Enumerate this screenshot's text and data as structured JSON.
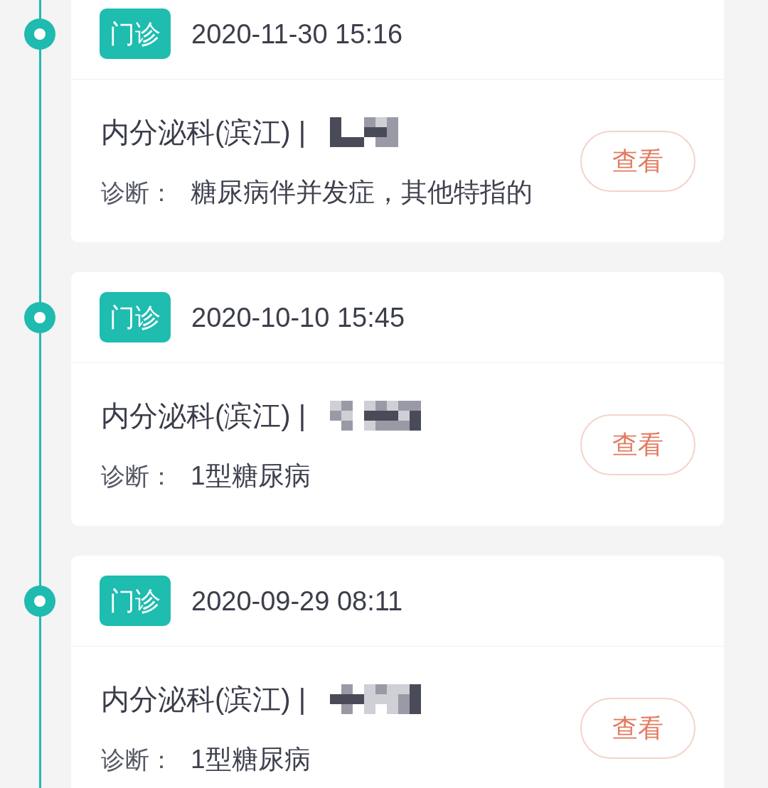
{
  "records": [
    {
      "visit_type": "门诊",
      "datetime": "2020-11-30 15:16",
      "department": "内分泌科(滨江) |",
      "diagnosis_label": "诊断：",
      "diagnosis": "糖尿病伴并发症，其他特指的",
      "action_button": "查看"
    },
    {
      "visit_type": "门诊",
      "datetime": "2020-10-10 15:45",
      "department": "内分泌科(滨江) |",
      "diagnosis_label": "诊断：",
      "diagnosis": "1型糖尿病",
      "action_button": "查看"
    },
    {
      "visit_type": "门诊",
      "datetime": "2020-09-29 08:11",
      "department": "内分泌科(滨江) |",
      "diagnosis_label": "诊断：",
      "diagnosis": "1型糖尿病",
      "action_button": "查看"
    }
  ]
}
